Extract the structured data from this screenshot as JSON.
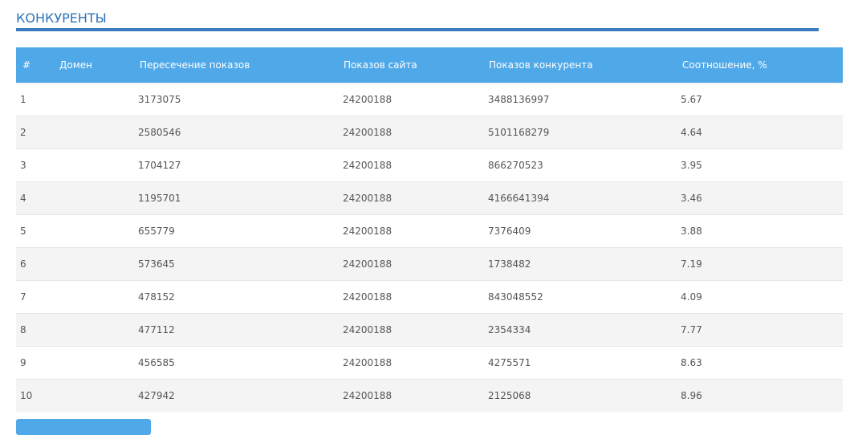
{
  "section": {
    "title": "КОНКУРЕНТЫ"
  },
  "table": {
    "headers": [
      "#",
      "Домен",
      "Пересечение показов",
      "Показов сайта",
      "Показов конкурента",
      "Соотношение, %"
    ],
    "rows": [
      [
        "1",
        "",
        "3173075",
        "24200188",
        "3488136997",
        "5.67"
      ],
      [
        "2",
        "",
        "2580546",
        "24200188",
        "5101168279",
        "4.64"
      ],
      [
        "3",
        "",
        "1704127",
        "24200188",
        "866270523",
        "3.95"
      ],
      [
        "4",
        "",
        "1195701",
        "24200188",
        "4166641394",
        "3.46"
      ],
      [
        "5",
        "",
        "655779",
        "24200188",
        "7376409",
        "3.88"
      ],
      [
        "6",
        "",
        "573645",
        "24200188",
        "1738482",
        "7.19"
      ],
      [
        "7",
        "",
        "478152",
        "24200188",
        "843048552",
        "4.09"
      ],
      [
        "8",
        "",
        "477112",
        "24200188",
        "2354334",
        "7.77"
      ],
      [
        "9",
        "",
        "456585",
        "24200188",
        "4275571",
        "8.63"
      ],
      [
        "10",
        "",
        "427942",
        "24200188",
        "2125068",
        "8.96"
      ]
    ]
  },
  "colors": {
    "accent": "#4fa8e8",
    "title": "#2f73b8",
    "rule": "#3b7bbf"
  }
}
